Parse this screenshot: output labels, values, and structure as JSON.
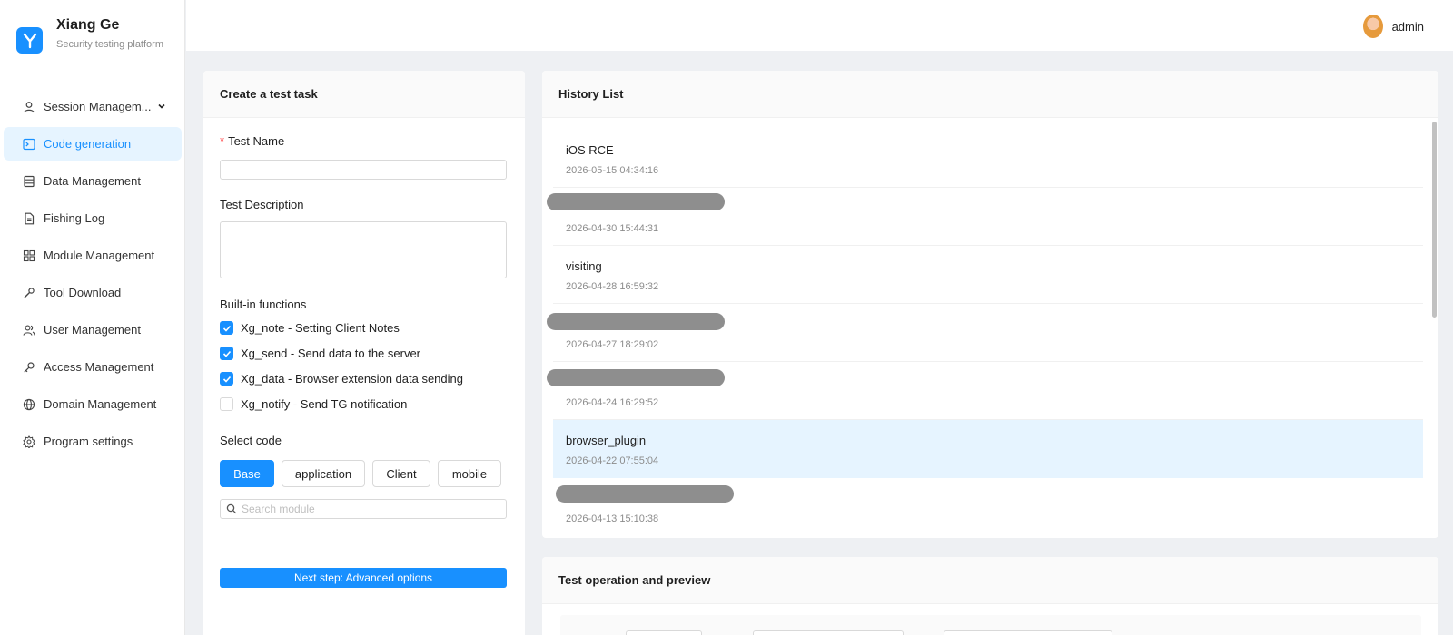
{
  "app": {
    "title": "Xiang Ge",
    "subtitle": "Security testing platform",
    "logo_letter": "Y",
    "accent": "#1890ff"
  },
  "header": {
    "username": "admin"
  },
  "sidebar": {
    "items": [
      {
        "label": "Session Managem...",
        "icon": "user-icon",
        "active": false,
        "expandable": true
      },
      {
        "label": "Code generation",
        "icon": "terminal-icon",
        "active": true
      },
      {
        "label": "Data Management",
        "icon": "database-icon",
        "active": false
      },
      {
        "label": "Fishing Log",
        "icon": "file-icon",
        "active": false
      },
      {
        "label": "Module Management",
        "icon": "grid-icon",
        "active": false
      },
      {
        "label": "Tool Download",
        "icon": "wrench-icon",
        "active": false
      },
      {
        "label": "User Management",
        "icon": "users-icon",
        "active": false
      },
      {
        "label": "Access Management",
        "icon": "key-icon",
        "active": false
      },
      {
        "label": "Domain Management",
        "icon": "globe-icon",
        "active": false
      },
      {
        "label": "Program settings",
        "icon": "gear-icon",
        "active": false
      }
    ]
  },
  "create_task": {
    "title": "Create a test task",
    "test_name_label": "Test Name",
    "test_name_value": "",
    "test_desc_label": "Test Description",
    "test_desc_value": "",
    "builtin_label": "Built-in functions",
    "functions": [
      {
        "label": "Xg_note - Setting Client Notes",
        "checked": true
      },
      {
        "label": "Xg_send - Send data to the server",
        "checked": true
      },
      {
        "label": "Xg_data - Browser extension data sending",
        "checked": true
      },
      {
        "label": "Xg_notify - Send TG notification",
        "checked": false
      }
    ],
    "select_code_label": "Select code",
    "code_options": [
      {
        "label": "Base",
        "selected": true
      },
      {
        "label": "application",
        "selected": false
      },
      {
        "label": "Client",
        "selected": false
      },
      {
        "label": "mobile",
        "selected": false
      }
    ],
    "search_placeholder": "Search module",
    "next_button": "Next step: Advanced options"
  },
  "history": {
    "title": "History List",
    "items": [
      {
        "name": "iOS RCE",
        "time": "2026-05-15 04:34:16",
        "redacted": false,
        "selected": false
      },
      {
        "name": "",
        "time": "2026-04-30 15:44:31",
        "redacted": true,
        "selected": false
      },
      {
        "name": "visiting",
        "time": "2026-04-28 16:59:32",
        "redacted": false,
        "selected": false
      },
      {
        "name": "",
        "time": "2026-04-27 18:29:02",
        "redacted": true,
        "selected": false
      },
      {
        "name": "",
        "time": "2026-04-24 16:29:52",
        "redacted": true,
        "selected": false
      },
      {
        "name": "browser_plugin",
        "time": "2026-04-22 07:55:04",
        "redacted": false,
        "selected": true
      },
      {
        "name": "",
        "time": "2026-04-13 15:10:38",
        "redacted": true,
        "selected": false
      }
    ]
  },
  "preview": {
    "title": "Test operation and preview"
  }
}
